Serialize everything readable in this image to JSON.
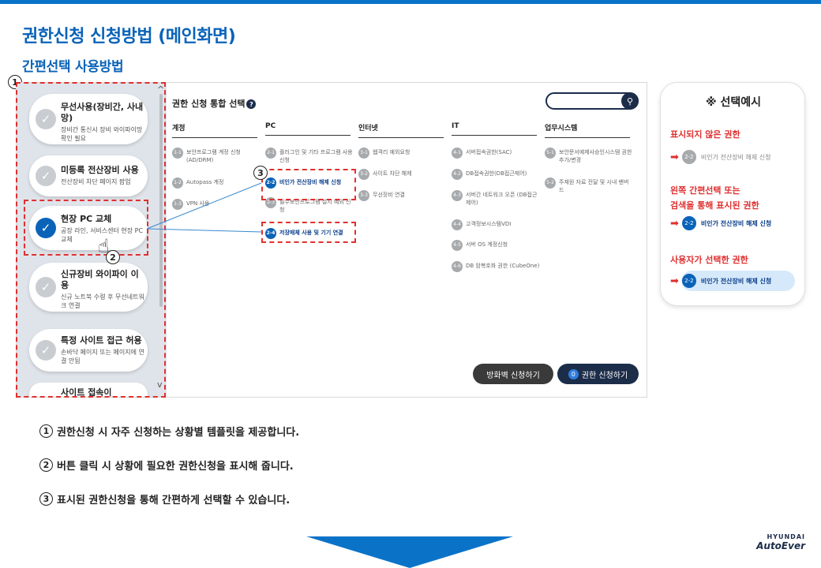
{
  "page": {
    "title": "권한신청 신청방법 (메인화면)",
    "subtitle": "간편선택 사용방법"
  },
  "markers": {
    "m1": "1",
    "m2": "2",
    "m3": "3"
  },
  "sidebar": {
    "scroll_up": "^",
    "scroll_down": "v",
    "cards": [
      {
        "title": "무선사용(장비간, 사내망)",
        "desc": "장비간 통신시 장비 와이파이망 확인 필요"
      },
      {
        "title": "미등록 전산장비 사용",
        "desc": "전산장비 차단 페이지 팝업"
      },
      {
        "title": "현장 PC 교체",
        "desc": "공장 라인, 서비스센터 현장 PC교체"
      },
      {
        "title": "신규장비 와이파이 이용",
        "desc": "신규 노트북 수령 후 무선네트워크 연결"
      },
      {
        "title": "특정 사이트 접근 허용",
        "desc": "손바닥 페이지 또는 페이지에 연결 안됨"
      },
      {
        "title": "사이트 접속이",
        "desc": ""
      }
    ]
  },
  "main": {
    "title": "권한 신청 통합 선택",
    "help_icon": "?",
    "search_icon": "search",
    "columns": [
      {
        "header": "계정",
        "items": [
          {
            "num": "1-1",
            "text": "보안프로그램 계정 신청 (AD/DRM)"
          },
          {
            "num": "1-2",
            "text": "Autopass 계정"
          },
          {
            "num": "1-3",
            "text": "VPN 사용"
          }
        ]
      },
      {
        "header": "PC",
        "items": [
          {
            "num": "2-1",
            "text": "플러그인 및 기타 프로그램 사용 신청"
          },
          {
            "num": "2-2",
            "text": "비인가 전산장비 해제 신청"
          },
          {
            "num": "2-3",
            "text": "필수보안프로그램 설치 예외 신청"
          },
          {
            "num": "2-4",
            "text": "저장매체 사용 및 기기 연결"
          }
        ]
      },
      {
        "header": "인터넷",
        "items": [
          {
            "num": "3-1",
            "text": "웹격리 예외요청"
          },
          {
            "num": "3-2",
            "text": "사이트 차단 해제"
          },
          {
            "num": "3-3",
            "text": "무선장비 연결"
          }
        ]
      },
      {
        "header": "IT",
        "items": [
          {
            "num": "4-1",
            "text": "서버접속권한(SAC)"
          },
          {
            "num": "4-2",
            "text": "DB접속권한(DB접근제어)"
          },
          {
            "num": "4-3",
            "text": "서버간 네트워크 오픈 (DB접근제어)"
          },
          {
            "num": "4-4",
            "text": "고객정보시스템VDI"
          },
          {
            "num": "4-5",
            "text": "서버 OS 계정신청"
          },
          {
            "num": "4-6",
            "text": "DB 암복호화 권한 (CubeOne)"
          }
        ]
      },
      {
        "header": "업무시스템",
        "items": [
          {
            "num": "5-1",
            "text": "보안문서예제사승인시스템 권한 추가/변경"
          },
          {
            "num": "5-2",
            "text": "주재원 자료 전달 및 시내 밴버드"
          }
        ]
      }
    ],
    "btn_firewall": "방화벽 신청하기",
    "btn_apply_badge": "0",
    "btn_apply": "권한 신청하기"
  },
  "example": {
    "title": "※ 선택예시",
    "label1": "표시되지 않은 권한",
    "label2a": "왼쪽 간편선택 또는",
    "label2b": "검색을 통해 표시된 권한",
    "label3": "사용자가 선택한 권한",
    "item_num": "2-2",
    "item_text": "비인가 전산장비 해제 신청"
  },
  "notes": [
    {
      "num": "1",
      "text": "권한신청 시 자주 신청하는 상황별 템플릿을 제공합니다."
    },
    {
      "num": "2",
      "text": "버튼 클릭 시 상황에 필요한 권한신청을 표시해 줍니다."
    },
    {
      "num": "3",
      "text": "표시된 권한신청을 통해 간편하게 선택할 수 있습니다."
    }
  ],
  "logo": {
    "top": "HYUNDAI",
    "bottom": "AutoEver"
  },
  "colors": {
    "brand_blue": "#0a63b8",
    "navy": "#1c2d4a",
    "highlight_red": "#e03030",
    "gray_num": "#a7aaad"
  }
}
